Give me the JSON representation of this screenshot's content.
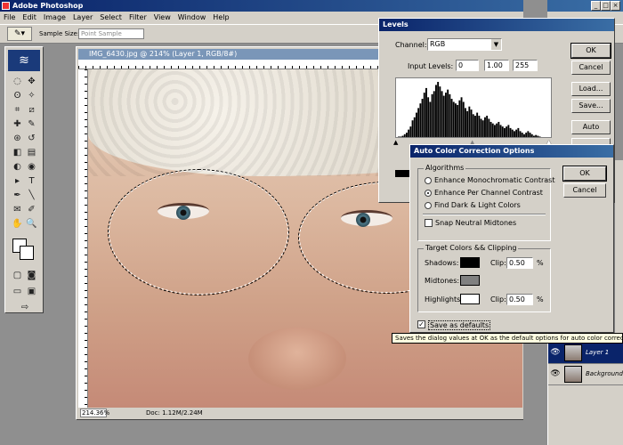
{
  "app": {
    "title": "Adobe Photoshop"
  },
  "menu": [
    "File",
    "Edit",
    "Image",
    "Layer",
    "Select",
    "Filter",
    "View",
    "Window",
    "Help"
  ],
  "options": {
    "sample_size_label": "Sample Size:",
    "sample_size_value": "Point Sample"
  },
  "document": {
    "title": "IMG_6430.jpg @ 214% (Layer 1, RGB/8#)",
    "zoom": "214.36%",
    "doc_info": "Doc: 1.12M/2.24M"
  },
  "levels": {
    "title": "Levels",
    "channel_label": "Channel:",
    "channel_value": "RGB",
    "input_label": "Input Levels:",
    "input_black": "0",
    "input_gamma": "1.00",
    "input_white": "255",
    "buttons": {
      "ok": "OK",
      "cancel": "Cancel",
      "load": "Load...",
      "save": "Save...",
      "auto": "Auto"
    },
    "histogram": [
      2,
      3,
      3,
      4,
      6,
      8,
      12,
      16,
      24,
      28,
      34,
      40,
      46,
      52,
      60,
      66,
      54,
      48,
      58,
      62,
      70,
      74,
      68,
      62,
      56,
      60,
      64,
      58,
      52,
      48,
      46,
      44,
      50,
      54,
      48,
      40,
      36,
      42,
      38,
      32,
      30,
      34,
      30,
      26,
      24,
      28,
      30,
      26,
      22,
      20,
      18,
      20,
      22,
      18,
      16,
      14,
      16,
      18,
      14,
      12,
      10,
      12,
      14,
      10,
      8,
      6,
      8,
      10,
      8,
      6,
      4,
      5,
      4,
      3,
      2,
      2,
      1,
      2,
      1,
      1
    ]
  },
  "acc": {
    "title": "Auto Color Correction Options",
    "algorithms_title": "Algorithms",
    "algo_options": [
      "Enhance Monochromatic Contrast",
      "Enhance Per Channel Contrast",
      "Find Dark & Light Colors"
    ],
    "algo_selected": 1,
    "snap_label": "Snap Neutral Midtones",
    "targets_title": "Target Colors && Clipping",
    "shadows_label": "Shadows:",
    "midtones_label": "Midtones:",
    "highlights_label": "Highlights:",
    "clip_label": "Clip:",
    "shadows_clip": "0.50",
    "highlights_clip": "0.50",
    "pct": "%",
    "shadows_color": "#000000",
    "midtones_color": "#808080",
    "highlights_color": "#ffffff",
    "save_defaults_label": "Save as defaults",
    "ok": "OK",
    "cancel": "Cancel"
  },
  "tooltip": "Saves the dialog values at OK as the default options for auto color correction",
  "layers": [
    {
      "name": "Layer 1",
      "selected": true
    },
    {
      "name": "Background",
      "selected": false
    }
  ]
}
